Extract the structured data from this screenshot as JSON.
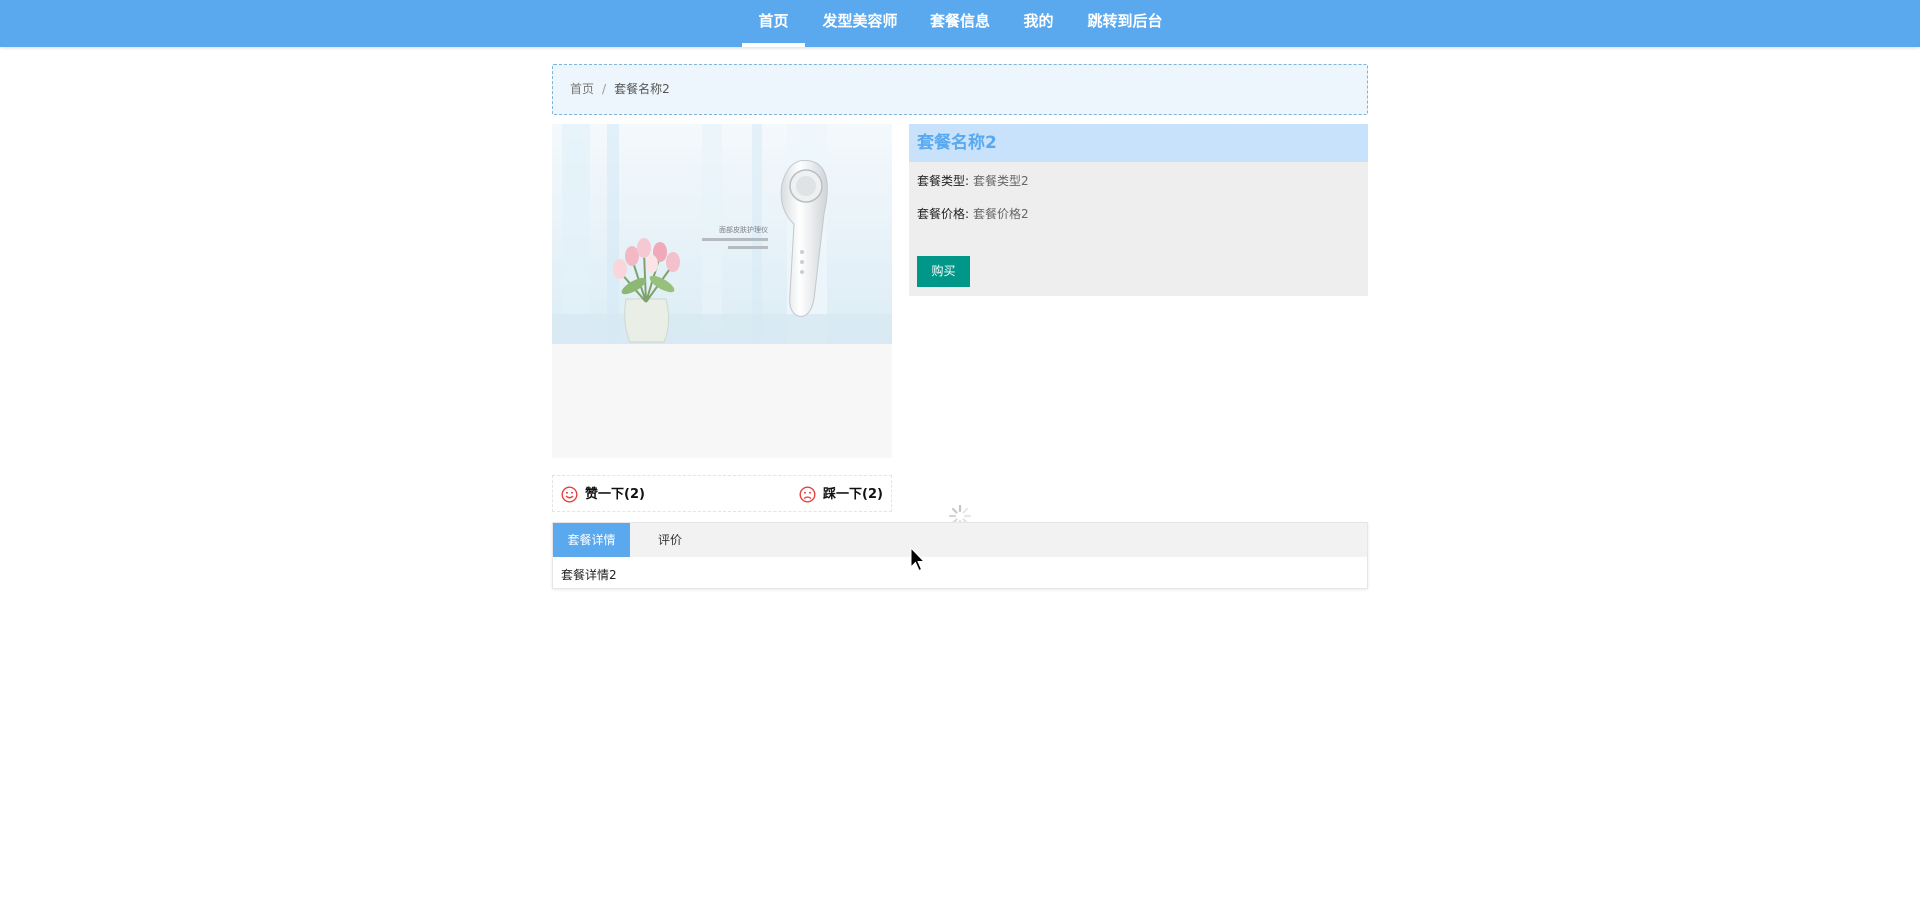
{
  "nav": {
    "items": [
      {
        "label": "首页",
        "active": true
      },
      {
        "label": "发型美容师",
        "active": false
      },
      {
        "label": "套餐信息",
        "active": false
      },
      {
        "label": "我的",
        "active": false
      },
      {
        "label": "跳转到后台",
        "active": false
      }
    ]
  },
  "breadcrumb": {
    "home": "首页",
    "separator": "/",
    "current": "套餐名称2"
  },
  "product": {
    "image_icon": "beauty-device-product-image",
    "image_caption": "面部皮肤护理仪",
    "name": "套餐名称2",
    "type_label": "套餐类型:",
    "type_value": "套餐类型2",
    "price_label": "套餐价格:",
    "price_value": "套餐价格2",
    "buy_label": "购买"
  },
  "votes": {
    "like_label": "赞一下(2)",
    "dislike_label": "踩一下(2)"
  },
  "tabs": {
    "items": [
      {
        "label": "套餐详情",
        "active": true
      },
      {
        "label": "评价",
        "active": false
      }
    ],
    "content": "套餐详情2"
  },
  "colors": {
    "nav_bg": "#5aa9ef",
    "title_bg": "#c8e2fb",
    "buy_button": "#009688",
    "vote_icon": "#e64340"
  }
}
